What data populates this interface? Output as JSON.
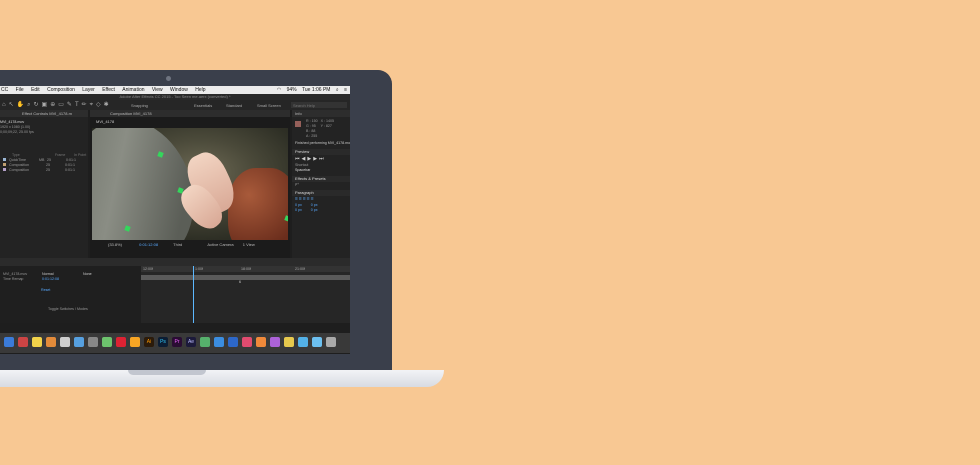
{
  "menu": {
    "items": [
      "CC",
      "File",
      "Edit",
      "Composition",
      "Layer",
      "Effect",
      "Animation",
      "View",
      "Window",
      "Help"
    ],
    "battery": "94%",
    "clock": "Tue 1:06 PM"
  },
  "window_title": "Adobe After Effects CC 2015 - Too Seen me.aerx (converted) *",
  "toolbar": {
    "snapping": "Snapping",
    "workspaces": [
      "Essentials",
      "Standard",
      "Small Screen"
    ],
    "search_placeholder": "Search Help"
  },
  "project_panel": {
    "tab_label": "Effect Controls MVI_4178.m",
    "file_name": "MVI_4178.mov",
    "file_info": [
      "1920 x 1080 (1.00)",
      "0;00;09;22, 25.00 fps"
    ],
    "columns": [
      "Type",
      "Frame",
      "In Point"
    ],
    "rows": [
      {
        "color": "#9ab6d4",
        "type": "QuickTime",
        "size": "MB",
        "fps": "25",
        "in": "0:01:1"
      },
      {
        "color": "#c0a070",
        "type": "Composition",
        "size": "",
        "fps": "25",
        "in": "0:01:1"
      },
      {
        "color": "#b4a0c8",
        "type": "Composition",
        "size": "",
        "fps": "25",
        "in": "0:01:1"
      }
    ]
  },
  "composition": {
    "tab_label": "Composition MVI_4178",
    "sub_tab": "MVI_4178",
    "zoom": "(33.8%)",
    "timecode": "0:01:12:08",
    "view_mode": "Third",
    "camera": "Active Camera",
    "views": "1 View"
  },
  "info_panel": {
    "title": "Info",
    "rgba": [
      "R : 150",
      "G : 95",
      "B : 88",
      "A : 255"
    ],
    "xy": [
      "X : 1405",
      "Y : 827"
    ],
    "status": "Finished performing MVI_4178.mov"
  },
  "preview_panel": {
    "title": "Preview",
    "shortcut_label": "Shortcut",
    "shortcut_value": "Spacebar"
  },
  "effects_panel": {
    "title": "Effects & Presets",
    "search_placeholder": "ρ+"
  },
  "paragraph_panel": {
    "title": "Paragraph",
    "values": [
      "0 px",
      "0 px",
      "0 px",
      "0 px",
      "0 px"
    ]
  },
  "timeline": {
    "tab_label": "MVI_4178",
    "source_name": "MVI_4178.mov",
    "mode": "Normal",
    "parent": "None",
    "time_remap_label": "Time Remap",
    "time_remap_value": "0:01:12:08",
    "reset_label": "Reset",
    "toggle_label": "Toggle Switches / Modes",
    "ruler": [
      "12:00f",
      "1:00f",
      "18:00f",
      "21:00f"
    ],
    "keyframe_value": "6"
  },
  "colors": {
    "background": "#f8c893",
    "laptop_frame": "#3a3f4b",
    "accent": "#58a9ff",
    "tracker": "#34d65c"
  }
}
